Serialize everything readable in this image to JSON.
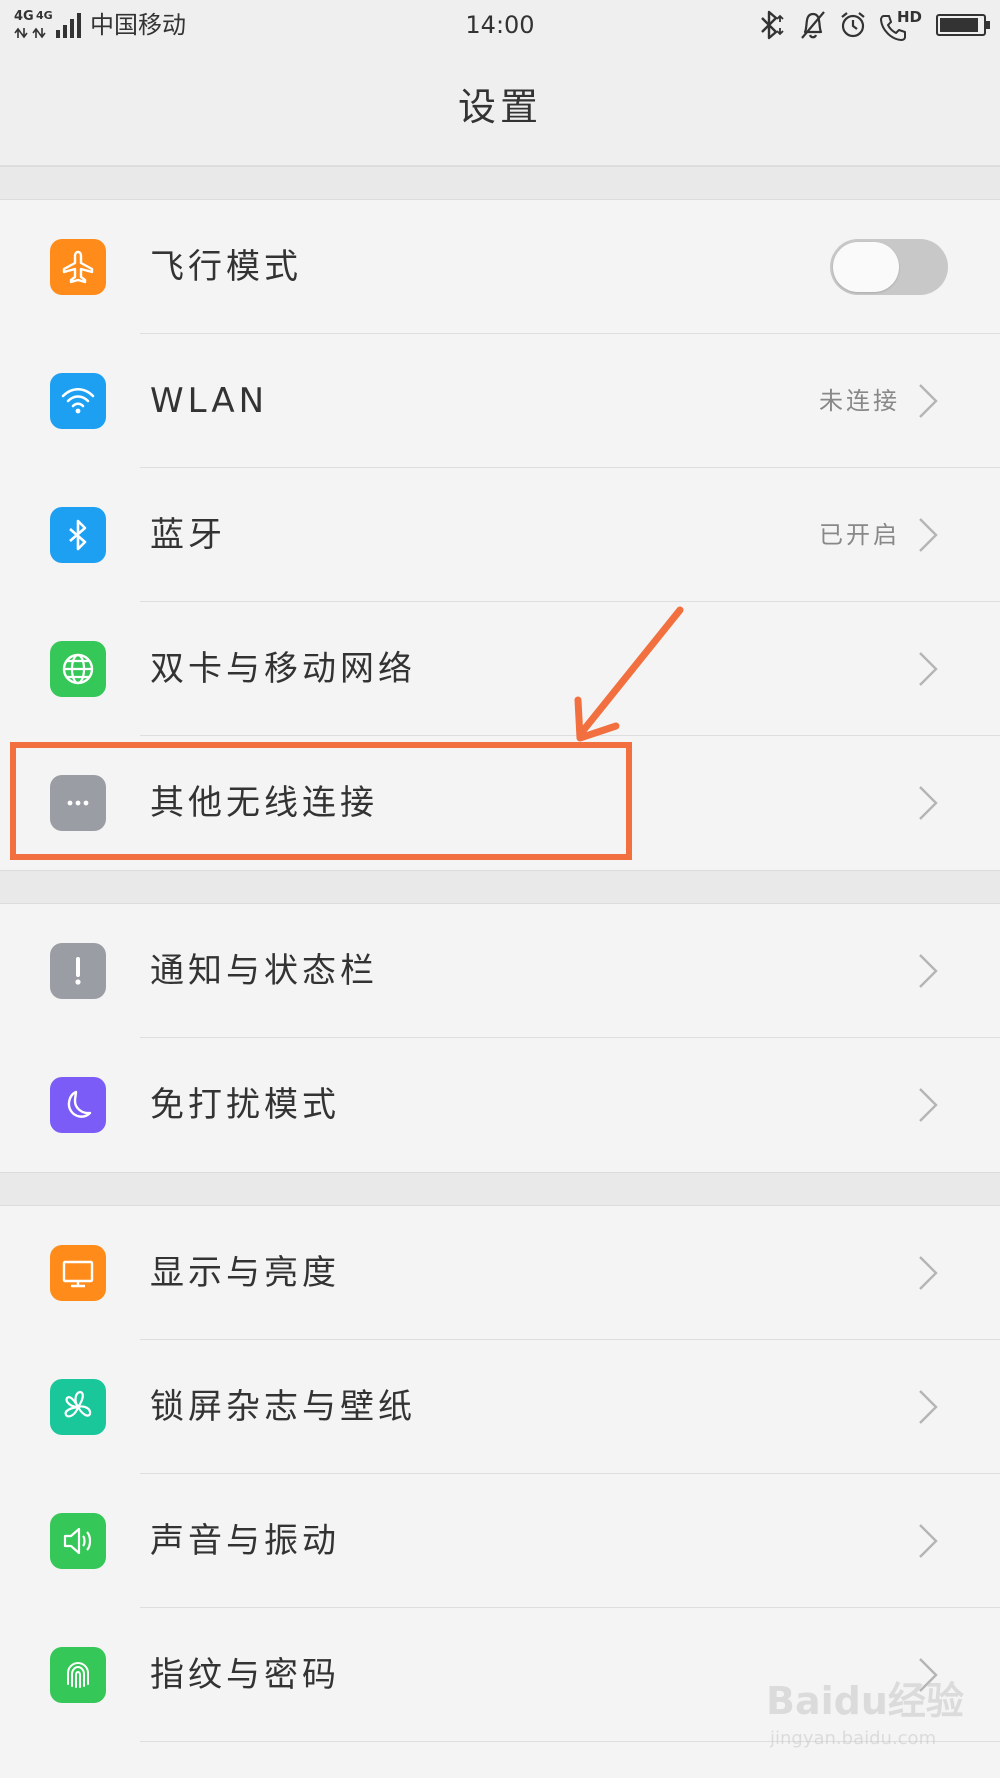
{
  "status_bar": {
    "net_label_1": "4G",
    "net_label_2": "4G",
    "carrier": "中国移动",
    "time": "14:00",
    "hd_label": "HD",
    "icons": [
      "signal-icon",
      "bluetooth-icon",
      "silent-bell-icon",
      "alarm-icon",
      "hd-call-icon",
      "battery-icon"
    ]
  },
  "header": {
    "title": "设置"
  },
  "groups": [
    {
      "items": [
        {
          "label": "飞行模式",
          "icon": "airplane-icon",
          "icon_color": "#ff8c1a",
          "control": "toggle",
          "toggle_on": false
        },
        {
          "label": "WLAN",
          "icon": "wifi-icon",
          "icon_color": "#1ea0f2",
          "value": "未连接",
          "control": "chevron"
        },
        {
          "label": "蓝牙",
          "icon": "bluetooth-icon",
          "icon_color": "#1ea0f2",
          "value": "已开启",
          "control": "chevron"
        },
        {
          "label": "双卡与移动网络",
          "icon": "globe-icon",
          "icon_color": "#35c758",
          "control": "chevron"
        },
        {
          "label": "其他无线连接",
          "icon": "more-dots-icon",
          "icon_color": "#9a9da3",
          "control": "chevron"
        }
      ]
    },
    {
      "items": [
        {
          "label": "通知与状态栏",
          "icon": "exclamation-icon",
          "icon_color": "#9a9da3",
          "control": "chevron"
        },
        {
          "label": "免打扰模式",
          "icon": "moon-icon",
          "icon_color": "#7b5cf6",
          "control": "chevron"
        }
      ]
    },
    {
      "items": [
        {
          "label": "显示与亮度",
          "icon": "monitor-icon",
          "icon_color": "#ff8c1a",
          "control": "chevron"
        },
        {
          "label": "锁屏杂志与壁纸",
          "icon": "pinwheel-icon",
          "icon_color": "#1ac79a",
          "control": "chevron"
        },
        {
          "label": "声音与振动",
          "icon": "speaker-icon",
          "icon_color": "#35c758",
          "control": "chevron"
        },
        {
          "label": "指纹与密码",
          "icon": "fingerprint-icon",
          "icon_color": "#35c758",
          "control": "chevron"
        }
      ]
    }
  ],
  "annotation": {
    "color": "#f2703f"
  },
  "watermark": {
    "logo": "Baidu经验",
    "url": "jingyan.baidu.com"
  }
}
